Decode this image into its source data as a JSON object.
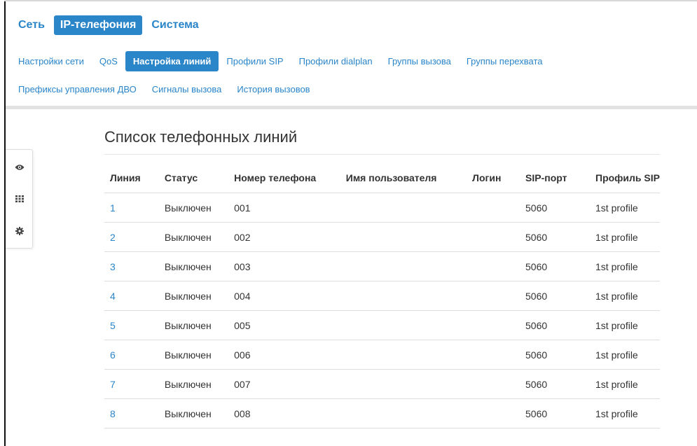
{
  "top_nav": {
    "tabs": [
      "Сеть",
      "IP-телефония",
      "Система"
    ],
    "active": "IP-телефония"
  },
  "sub_nav": {
    "row1": [
      "Настройки сети",
      "QoS",
      "Настройка линий",
      "Профили SIP",
      "Профили dialplan",
      "Группы вызова",
      "Группы перехвата"
    ],
    "row2": [
      "Префиксы управления ДВО",
      "Сигналы вызова",
      "История вызовов"
    ],
    "active": "Настройка линий"
  },
  "side_panel": {
    "icons": [
      "eye-icon",
      "grid-icon",
      "gear-icon"
    ]
  },
  "main": {
    "title": "Список телефонных линий",
    "columns": [
      "Линия",
      "Статус",
      "Номер телефона",
      "Имя пользователя",
      "Логин",
      "SIP-порт",
      "Профиль SIP"
    ],
    "rows": [
      [
        "1",
        "Выключен",
        "001",
        "",
        "",
        "5060",
        "1st profile"
      ],
      [
        "2",
        "Выключен",
        "002",
        "",
        "",
        "5060",
        "1st profile"
      ],
      [
        "3",
        "Выключен",
        "003",
        "",
        "",
        "5060",
        "1st profile"
      ],
      [
        "4",
        "Выключен",
        "004",
        "",
        "",
        "5060",
        "1st profile"
      ],
      [
        "5",
        "Выключен",
        "005",
        "",
        "",
        "5060",
        "1st profile"
      ],
      [
        "6",
        "Выключен",
        "006",
        "",
        "",
        "5060",
        "1st profile"
      ],
      [
        "7",
        "Выключен",
        "007",
        "",
        "",
        "5060",
        "1st profile"
      ],
      [
        "8",
        "Выключен",
        "008",
        "",
        "",
        "5060",
        "1st profile"
      ]
    ]
  },
  "colors": {
    "accent": "#2a85c9",
    "text": "#333333",
    "divider": "#dddddd"
  }
}
